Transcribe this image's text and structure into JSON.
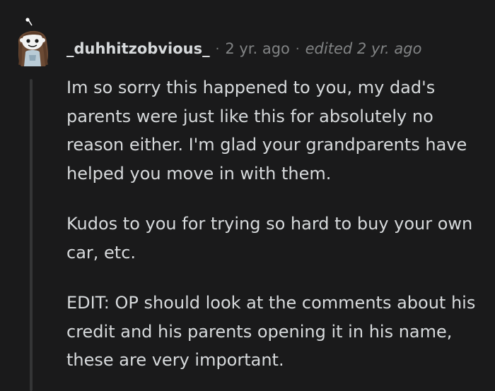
{
  "comment": {
    "author": "_duhhitzobvious_",
    "separator": "·",
    "age": "2 yr. ago",
    "edited": "edited 2 yr. ago",
    "paragraphs": [
      "Im so sorry this happened to you, my dad's parents were just like this for absolutely no reason either. I'm glad your grandparents have helped you move in with them.",
      "Kudos to you for trying so hard to buy your own car, etc.",
      "EDIT: OP should look at the comments about his credit and his parents opening it in his name, these are very important."
    ]
  },
  "colors": {
    "background": "#1a1a1b",
    "text": "#d7dadc",
    "muted": "#818384",
    "thread_line": "#343536"
  }
}
